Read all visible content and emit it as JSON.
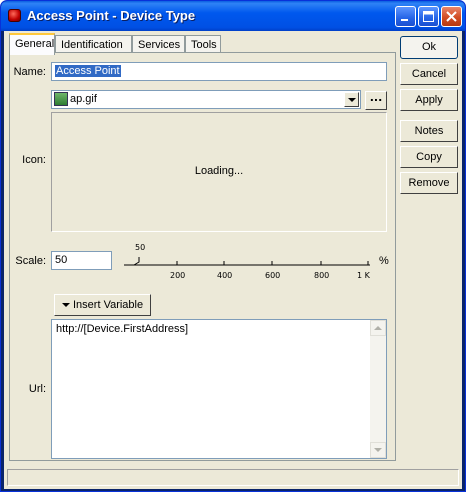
{
  "window": {
    "title": "Access Point - Device Type"
  },
  "tabs": [
    {
      "label": "General"
    },
    {
      "label": "Identification"
    },
    {
      "label": "Services"
    },
    {
      "label": "Tools"
    }
  ],
  "general": {
    "name_label": "Name:",
    "name_value": "Access Point",
    "icon_label": "Icon:",
    "icon_file": "ap.gif",
    "icon_browse": "...",
    "icon_preview_text": "Loading...",
    "scale_label": "Scale:",
    "scale_value": "50",
    "scale_unit": "%",
    "scale_pointer_label": "50",
    "scale_ticks": [
      "200",
      "400",
      "600",
      "800",
      "1 K"
    ],
    "insert_variable_label": "Insert Variable",
    "url_label": "Url:",
    "url_value": "http://[Device.FirstAddress]"
  },
  "buttons": {
    "ok": "Ok",
    "cancel": "Cancel",
    "apply": "Apply",
    "notes": "Notes",
    "copy": "Copy",
    "remove": "Remove"
  },
  "status": {
    "text": ""
  }
}
